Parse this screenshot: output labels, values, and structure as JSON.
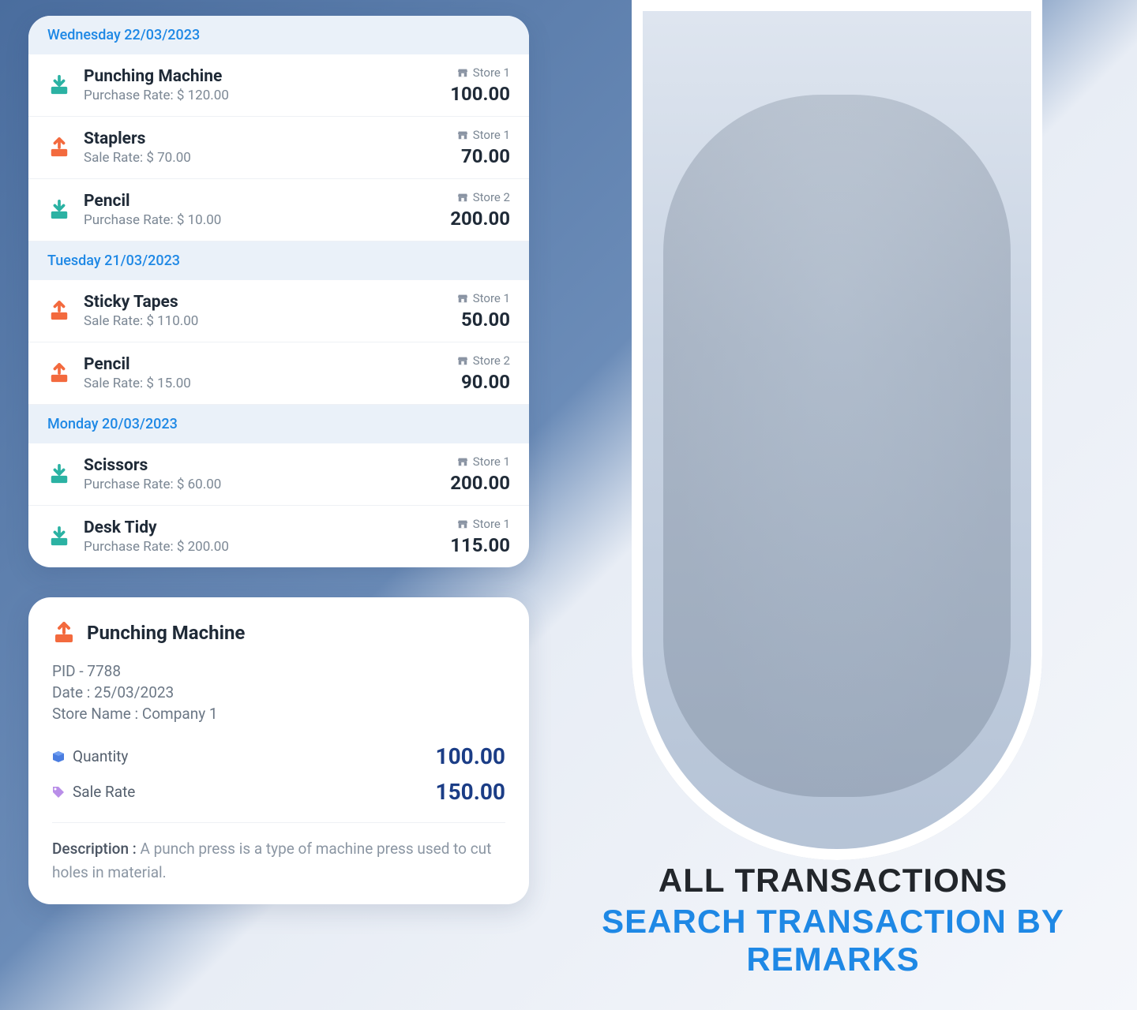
{
  "transactions": {
    "groups": [
      {
        "date": "Wednesday 22/03/2023",
        "items": [
          {
            "direction": "purchase",
            "title": "Punching Machine",
            "rate_label": "Purchase Rate: $ 120.00",
            "store": "Store 1",
            "amount": "100.00"
          },
          {
            "direction": "sale",
            "title": "Staplers",
            "rate_label": "Sale Rate: $ 70.00",
            "store": "Store 1",
            "amount": "70.00"
          },
          {
            "direction": "purchase",
            "title": "Pencil",
            "rate_label": "Purchase Rate: $ 10.00",
            "store": "Store 2",
            "amount": "200.00"
          }
        ]
      },
      {
        "date": "Tuesday 21/03/2023",
        "items": [
          {
            "direction": "sale",
            "title": "Sticky Tapes",
            "rate_label": "Sale Rate: $ 110.00",
            "store": "Store 1",
            "amount": "50.00"
          },
          {
            "direction": "sale",
            "title": "Pencil",
            "rate_label": "Sale Rate: $ 15.00",
            "store": "Store 2",
            "amount": "90.00"
          }
        ]
      },
      {
        "date": "Monday 20/03/2023",
        "items": [
          {
            "direction": "purchase",
            "title": "Scissors",
            "rate_label": "Purchase Rate: $ 60.00",
            "store": "Store 1",
            "amount": "200.00"
          },
          {
            "direction": "purchase",
            "title": "Desk Tidy",
            "rate_label": "Purchase Rate: $ 200.00",
            "store": "Store 1",
            "amount": "115.00"
          }
        ]
      }
    ]
  },
  "detail": {
    "direction": "sale",
    "title": "Punching Machine",
    "pid": "PID - 7788",
    "date": "Date : 25/03/2023",
    "store": "Store Name : Company 1",
    "quantity_label": "Quantity",
    "quantity_value": "100.00",
    "salerate_label": "Sale Rate",
    "salerate_value": "150.00",
    "description_label": "Description : ",
    "description_text": "A punch press is a type of machine press used to cut holes in material."
  },
  "banner": {
    "line1": "ALL TRANSACTIONS",
    "line2": "SEARCH TRANSACTION BY REMARKS"
  }
}
